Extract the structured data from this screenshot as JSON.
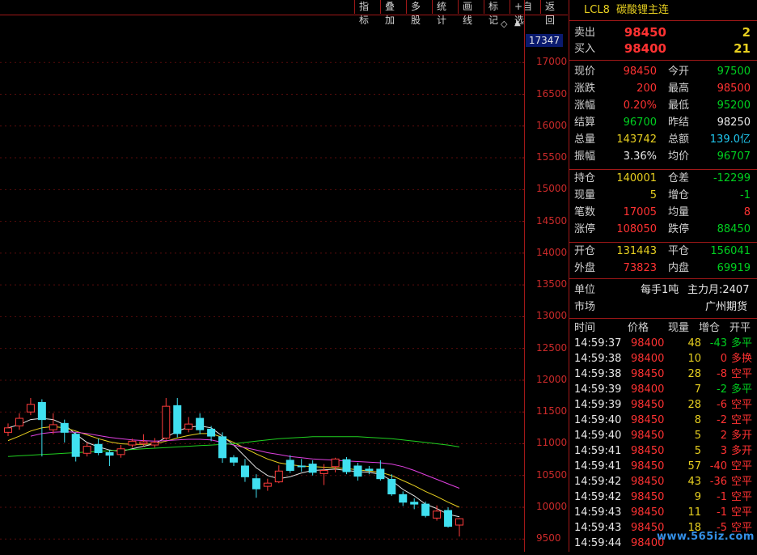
{
  "toolbar": {
    "buttons": [
      "指标",
      "叠加",
      "多股",
      "统计",
      "画线",
      "标记",
      "+自选",
      "返回"
    ]
  },
  "axis": {
    "top_price_box": "17347",
    "labels": [
      "17000",
      "16500",
      "16000",
      "15500",
      "15000",
      "14500",
      "14000",
      "13500",
      "13000",
      "12500",
      "12000",
      "11500",
      "11000",
      "10500",
      "10000",
      "9500"
    ]
  },
  "quote": {
    "code": "LCL8",
    "name": "碳酸锂主连",
    "sell_label": "卖出",
    "sell_price": "98450",
    "sell_vol": "2",
    "buy_label": "买入",
    "buy_price": "98400",
    "buy_vol": "21",
    "stats": [
      {
        "l1": "现价",
        "v1": "98450",
        "c1": "red",
        "l2": "今开",
        "v2": "97500",
        "c2": "green"
      },
      {
        "l1": "涨跌",
        "v1": "200",
        "c1": "red",
        "l2": "最高",
        "v2": "98500",
        "c2": "red"
      },
      {
        "l1": "涨幅",
        "v1": "0.20%",
        "c1": "red",
        "l2": "最低",
        "v2": "95200",
        "c2": "green"
      },
      {
        "l1": "结算",
        "v1": "96700",
        "c1": "green",
        "l2": "昨结",
        "v2": "98250",
        "c2": "white"
      },
      {
        "l1": "总量",
        "v1": "143742",
        "c1": "yellow",
        "l2": "总额",
        "v2": "139.0亿",
        "c2": "cyan"
      },
      {
        "l1": "振幅",
        "v1": "3.36%",
        "c1": "white",
        "l2": "均价",
        "v2": "96707",
        "c2": "green"
      }
    ],
    "stats2": [
      {
        "l1": "持仓",
        "v1": "140001",
        "c1": "yellow",
        "l2": "仓差",
        "v2": "-12299",
        "c2": "green"
      },
      {
        "l1": "现量",
        "v1": "5",
        "c1": "yellow",
        "l2": "增仓",
        "v2": "-1",
        "c2": "green"
      },
      {
        "l1": "笔数",
        "v1": "17005",
        "c1": "red",
        "l2": "均量",
        "v2": "8",
        "c2": "red"
      },
      {
        "l1": "涨停",
        "v1": "108050",
        "c1": "red",
        "l2": "跌停",
        "v2": "88450",
        "c2": "green"
      }
    ],
    "stats3": [
      {
        "l1": "开仓",
        "v1": "131443",
        "c1": "yellow",
        "l2": "平仓",
        "v2": "156041",
        "c2": "green"
      },
      {
        "l1": "外盘",
        "v1": "73823",
        "c1": "red",
        "l2": "内盘",
        "v2": "69919",
        "c2": "green"
      }
    ],
    "unit_label": "单位",
    "unit_value": "每手1吨",
    "main_month": "主力月:2407",
    "market_label": "市场",
    "market_value": "广州期货",
    "tick_header": [
      "时间",
      "价格",
      "现量",
      "增仓",
      "开平"
    ],
    "ticks": [
      {
        "t": "14:59:37",
        "p": "98400",
        "v": "48",
        "d": "-43",
        "dc": "green",
        "k": "多平",
        "kc": "green"
      },
      {
        "t": "14:59:38",
        "p": "98400",
        "v": "10",
        "d": "0",
        "dc": "red",
        "k": "多换",
        "kc": "red"
      },
      {
        "t": "14:59:38",
        "p": "98450",
        "v": "28",
        "d": "-8",
        "dc": "red",
        "k": "空平",
        "kc": "red"
      },
      {
        "t": "14:59:39",
        "p": "98400",
        "v": "7",
        "d": "-2",
        "dc": "green",
        "k": "多平",
        "kc": "green"
      },
      {
        "t": "14:59:39",
        "p": "98450",
        "v": "28",
        "d": "-6",
        "dc": "red",
        "k": "空平",
        "kc": "red"
      },
      {
        "t": "14:59:40",
        "p": "98450",
        "v": "8",
        "d": "-2",
        "dc": "red",
        "k": "空平",
        "kc": "red"
      },
      {
        "t": "14:59:40",
        "p": "98450",
        "v": "5",
        "d": "2",
        "dc": "red",
        "k": "多开",
        "kc": "red"
      },
      {
        "t": "14:59:41",
        "p": "98450",
        "v": "5",
        "d": "3",
        "dc": "red",
        "k": "多开",
        "kc": "red"
      },
      {
        "t": "14:59:41",
        "p": "98450",
        "v": "57",
        "d": "-40",
        "dc": "red",
        "k": "空平",
        "kc": "red"
      },
      {
        "t": "14:59:42",
        "p": "98450",
        "v": "43",
        "d": "-36",
        "dc": "red",
        "k": "空平",
        "kc": "red"
      },
      {
        "t": "14:59:42",
        "p": "98450",
        "v": "9",
        "d": "-1",
        "dc": "red",
        "k": "空平",
        "kc": "red"
      },
      {
        "t": "14:59:43",
        "p": "98450",
        "v": "11",
        "d": "-1",
        "dc": "red",
        "k": "空平",
        "kc": "red"
      },
      {
        "t": "14:59:43",
        "p": "98450",
        "v": "18",
        "d": "-5",
        "dc": "red",
        "k": "空平",
        "kc": "red"
      },
      {
        "t": "14:59:44",
        "p": "98400",
        "v": "",
        "d": "",
        "dc": "red",
        "k": "",
        "kc": "red"
      }
    ]
  },
  "watermark": "www.565iz.com",
  "chart_data": {
    "type": "candlestick",
    "y_axis_range": [
      9300,
      17347
    ],
    "candles": [
      {
        "o": 11180,
        "c": 11250,
        "h": 11320,
        "l": 11120
      },
      {
        "o": 11280,
        "c": 11400,
        "h": 11480,
        "l": 11220
      },
      {
        "o": 11500,
        "c": 11620,
        "h": 11720,
        "l": 11450
      },
      {
        "o": 11650,
        "c": 11380,
        "h": 11700,
        "l": 10800
      },
      {
        "o": 11220,
        "c": 11300,
        "h": 11480,
        "l": 11150
      },
      {
        "o": 11320,
        "c": 11180,
        "h": 11380,
        "l": 11020
      },
      {
        "o": 11150,
        "c": 10800,
        "h": 11180,
        "l": 10720
      },
      {
        "o": 10850,
        "c": 10960,
        "h": 11020,
        "l": 10800
      },
      {
        "o": 10990,
        "c": 10860,
        "h": 11080,
        "l": 10820
      },
      {
        "o": 10860,
        "c": 10820,
        "h": 10900,
        "l": 10650
      },
      {
        "o": 10830,
        "c": 10920,
        "h": 10980,
        "l": 10780
      },
      {
        "o": 10980,
        "c": 11040,
        "h": 11080,
        "l": 10940
      },
      {
        "o": 11000,
        "c": 11030,
        "h": 11150,
        "l": 10960
      },
      {
        "o": 10980,
        "c": 11020,
        "h": 11090,
        "l": 10940
      },
      {
        "o": 11090,
        "c": 11590,
        "h": 11720,
        "l": 11060
      },
      {
        "o": 11600,
        "c": 11160,
        "h": 11720,
        "l": 11100
      },
      {
        "o": 11230,
        "c": 11310,
        "h": 11420,
        "l": 11180
      },
      {
        "o": 11400,
        "c": 11220,
        "h": 11480,
        "l": 11150
      },
      {
        "o": 11230,
        "c": 11120,
        "h": 11280,
        "l": 11040
      },
      {
        "o": 11110,
        "c": 10780,
        "h": 11180,
        "l": 10700
      },
      {
        "o": 10780,
        "c": 10710,
        "h": 10820,
        "l": 10650
      },
      {
        "o": 10650,
        "c": 10480,
        "h": 10760,
        "l": 10400
      },
      {
        "o": 10450,
        "c": 10290,
        "h": 10520,
        "l": 10150
      },
      {
        "o": 10330,
        "c": 10380,
        "h": 10450,
        "l": 10260
      },
      {
        "o": 10400,
        "c": 10570,
        "h": 10660,
        "l": 10380
      },
      {
        "o": 10740,
        "c": 10580,
        "h": 10820,
        "l": 10540
      },
      {
        "o": 10650,
        "c": 10640,
        "h": 10760,
        "l": 10560
      },
      {
        "o": 10680,
        "c": 10550,
        "h": 10740,
        "l": 10500
      },
      {
        "o": 10530,
        "c": 10580,
        "h": 10680,
        "l": 10350
      },
      {
        "o": 10640,
        "c": 10760,
        "h": 10780,
        "l": 10550
      },
      {
        "o": 10750,
        "c": 10560,
        "h": 10790,
        "l": 10520
      },
      {
        "o": 10650,
        "c": 10490,
        "h": 10700,
        "l": 10420
      },
      {
        "o": 10600,
        "c": 10580,
        "h": 10650,
        "l": 10520
      },
      {
        "o": 10600,
        "c": 10450,
        "h": 10740,
        "l": 10420
      },
      {
        "o": 10440,
        "c": 10210,
        "h": 10520,
        "l": 10180
      },
      {
        "o": 10200,
        "c": 10080,
        "h": 10250,
        "l": 10020
      },
      {
        "o": 10080,
        "c": 10050,
        "h": 10140,
        "l": 9970
      },
      {
        "o": 10050,
        "c": 9870,
        "h": 10090,
        "l": 9840
      },
      {
        "o": 9830,
        "c": 9940,
        "h": 10030,
        "l": 9790
      },
      {
        "o": 9950,
        "c": 9700,
        "h": 10000,
        "l": 9680
      },
      {
        "o": 9720,
        "c": 9820,
        "h": 9830,
        "l": 9540
      }
    ],
    "ma_lines": [
      {
        "color": "#e8e8e8",
        "values": [
          11250,
          11300,
          11380,
          11400,
          11380,
          11300,
          11150,
          11020,
          10950,
          10900,
          10880,
          10920,
          10960,
          11000,
          11100,
          11200,
          11260,
          11280,
          11250,
          11120,
          10980,
          10800,
          10620,
          10500,
          10450,
          10480,
          10540,
          10580,
          10590,
          10600,
          10580,
          10560,
          10550,
          10520,
          10420,
          10280,
          10180,
          10050,
          9980,
          9890,
          9850
        ]
      },
      {
        "color": "#e8d020",
        "values": [
          11050,
          11120,
          11200,
          11250,
          11270,
          11250,
          11200,
          11140,
          11080,
          11030,
          11000,
          10990,
          10990,
          11000,
          11040,
          11090,
          11130,
          11160,
          11160,
          11100,
          11020,
          10930,
          10840,
          10760,
          10700,
          10670,
          10650,
          10640,
          10630,
          10620,
          10610,
          10590,
          10570,
          10550,
          10500,
          10420,
          10340,
          10250,
          10170,
          10080,
          10000
        ]
      },
      {
        "color": "#e040e0",
        "values": [
          null,
          null,
          11120,
          11160,
          11180,
          11190,
          11180,
          11160,
          11130,
          11100,
          11080,
          11060,
          11050,
          11040,
          11050,
          11060,
          11070,
          11070,
          11060,
          11020,
          10980,
          10940,
          10900,
          10860,
          10830,
          10800,
          10780,
          10760,
          10750,
          10740,
          10730,
          10720,
          10710,
          10700,
          10680,
          10640,
          10580,
          10510,
          10440,
          10370,
          10300
        ]
      },
      {
        "color": "#20d020",
        "values": [
          10800,
          10810,
          10820,
          10830,
          10840,
          10850,
          10860,
          10870,
          10880,
          10890,
          10900,
          10910,
          10920,
          10930,
          10940,
          10950,
          10960,
          10970,
          10980,
          10990,
          11000,
          11020,
          11040,
          11060,
          11080,
          11090,
          11100,
          11110,
          11110,
          11110,
          11110,
          11110,
          11100,
          11090,
          11080,
          11060,
          11040,
          11020,
          11000,
          10980,
          10950
        ]
      }
    ]
  }
}
